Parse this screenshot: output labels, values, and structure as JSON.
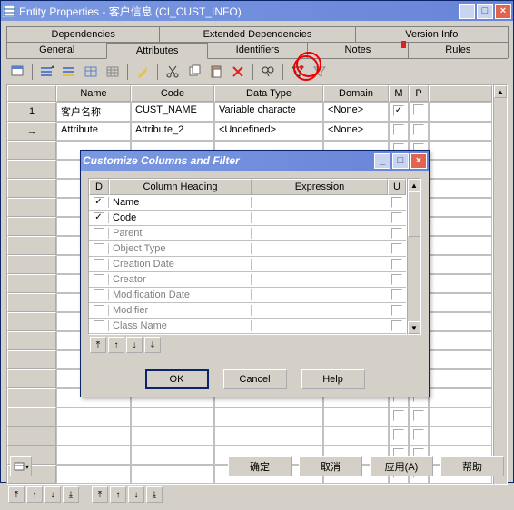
{
  "mainWindow": {
    "title": "Entity Properties - 客户信息 (CI_CUST_INFO)"
  },
  "tabsTop": {
    "dep": "Dependencies",
    "ext": "Extended Dependencies",
    "ver": "Version Info"
  },
  "tabsBot": {
    "gen": "General",
    "attr": "Attributes",
    "ident": "Identifiers",
    "notes": "Notes",
    "rules": "Rules"
  },
  "gridHead": {
    "name": "Name",
    "code": "Code",
    "dtype": "Data Type",
    "domain": "Domain",
    "m": "M",
    "p": "P"
  },
  "rows": [
    {
      "idx": "1",
      "name": "客户名称",
      "code": "CUST_NAME",
      "dtype": "Variable characte",
      "domain": "<None>",
      "m": true
    },
    {
      "idx": "",
      "name": "Attribute",
      "code": "Attribute_2",
      "dtype": "<Undefined>",
      "domain": "<None>",
      "m": false,
      "arrow": true
    }
  ],
  "dialog": {
    "title": "Customize Columns and Filter"
  },
  "dlgHead": {
    "d": "D",
    "ch": "Column Heading",
    "expr": "Expression",
    "u": "U"
  },
  "cols": [
    {
      "name": "Name",
      "d": true
    },
    {
      "name": "Code",
      "d": true
    },
    {
      "name": "Parent",
      "d": false
    },
    {
      "name": "Object Type",
      "d": false
    },
    {
      "name": "Creation Date",
      "d": false
    },
    {
      "name": "Creator",
      "d": false
    },
    {
      "name": "Modification Date",
      "d": false
    },
    {
      "name": "Modifier",
      "d": false
    },
    {
      "name": "Class Name",
      "d": false
    }
  ],
  "dlgBtn": {
    "ok": "OK",
    "cancel": "Cancel",
    "help": "Help"
  },
  "mainBtn": {
    "ok": "确定",
    "cancel": "取消",
    "apply": "应用(A)",
    "help": "帮助"
  }
}
